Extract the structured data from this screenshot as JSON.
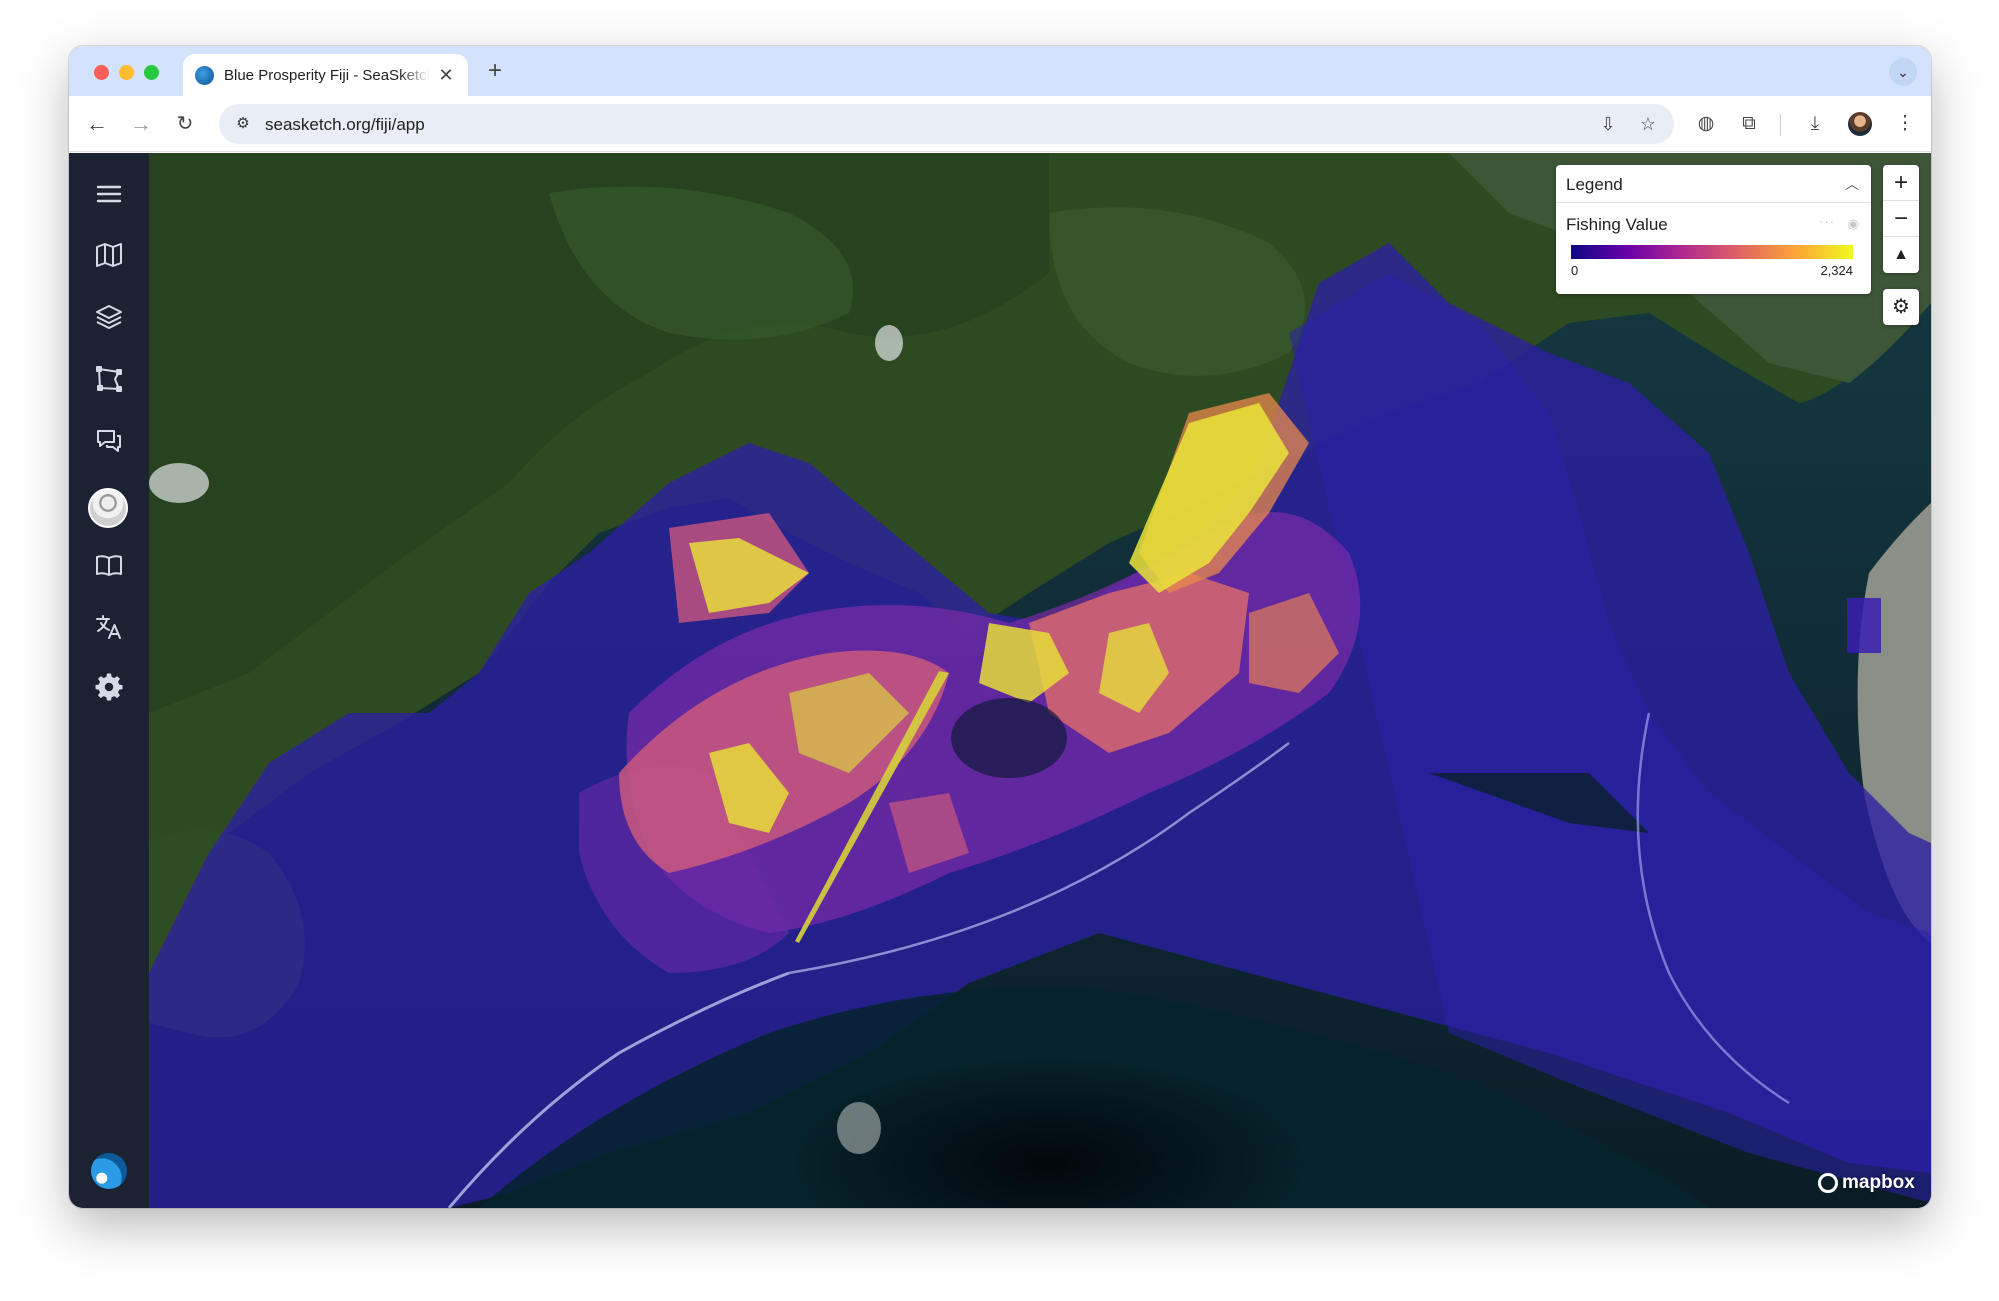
{
  "browser": {
    "tab_title": "Blue Prosperity Fiji - SeaSketch",
    "new_tab": "+",
    "tab_close": "✕",
    "url": "seasketch.org/fiji/app"
  },
  "sidebar": {
    "items": [
      {
        "name": "menu"
      },
      {
        "name": "maps"
      },
      {
        "name": "layers"
      },
      {
        "name": "sketches"
      },
      {
        "name": "forums"
      },
      {
        "name": "profile"
      },
      {
        "name": "about"
      },
      {
        "name": "translate"
      },
      {
        "name": "settings"
      }
    ]
  },
  "legend": {
    "title": "Legend",
    "layer": "Fishing Value",
    "min": "0",
    "max": "2,324",
    "ramp_colors": [
      "#0d0887",
      "#6a00a8",
      "#b12a90",
      "#e16462",
      "#fca636",
      "#f0f921"
    ]
  },
  "map_controls": {
    "zoom_in": "+",
    "zoom_out": "−",
    "compass": "▲"
  },
  "attribution": {
    "logo_text": "mapbox"
  }
}
